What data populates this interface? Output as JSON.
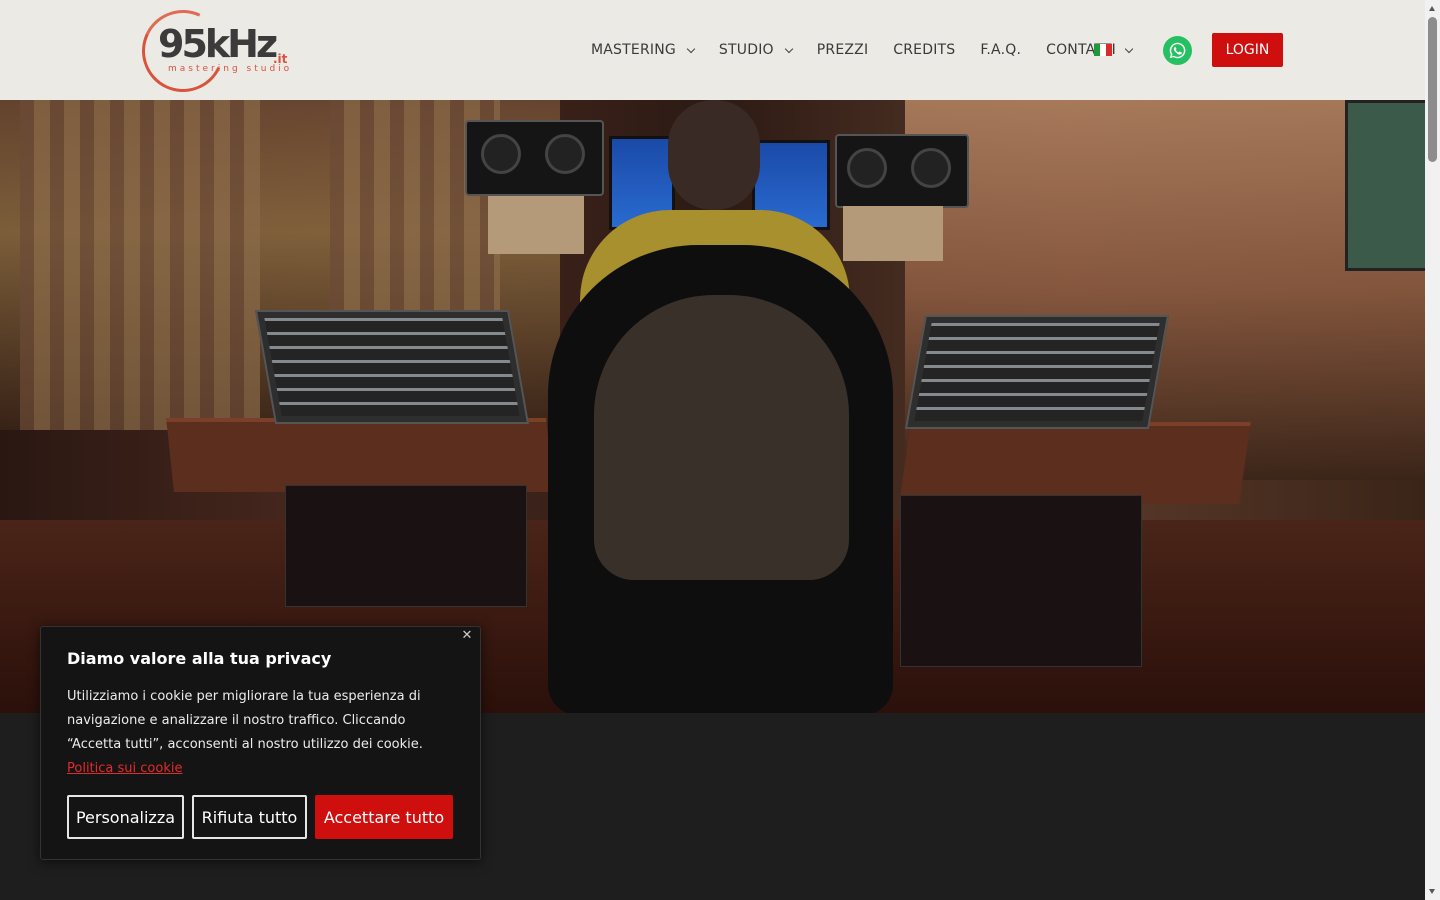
{
  "header": {
    "logo": {
      "brand": "95kHz",
      "tld": ".it",
      "tagline": "mastering studio"
    },
    "nav": [
      {
        "label": "MASTERING",
        "dropdown": true
      },
      {
        "label": "STUDIO",
        "dropdown": true
      },
      {
        "label": "PREZZI",
        "dropdown": false
      },
      {
        "label": "CREDITS",
        "dropdown": false
      },
      {
        "label": "F.A.Q.",
        "dropdown": false
      },
      {
        "label": "CONTATTI",
        "dropdown": false
      }
    ],
    "language_icon": "italy-flag-icon",
    "whatsapp_icon": "whatsapp-icon",
    "login_label": "LOGIN"
  },
  "cookie_banner": {
    "title": "Diamo valore alla tua privacy",
    "body": "Utilizziamo i cookie per migliorare la tua esperienza di navigazione e analizzare il nostro traffico. Cliccando “Accetta tutti”, acconsenti al nostro utilizzo dei cookie.",
    "link": "Politica sui cookie",
    "buttons": {
      "customize": "Personalizza",
      "reject": "Rifiuta tutto",
      "accept": "Accettare tutto"
    }
  },
  "colors": {
    "accent": "#cf0e0e",
    "header_bg": "#f4f2ec",
    "whatsapp": "#25c062",
    "dark_bg": "#1e1e1e"
  }
}
